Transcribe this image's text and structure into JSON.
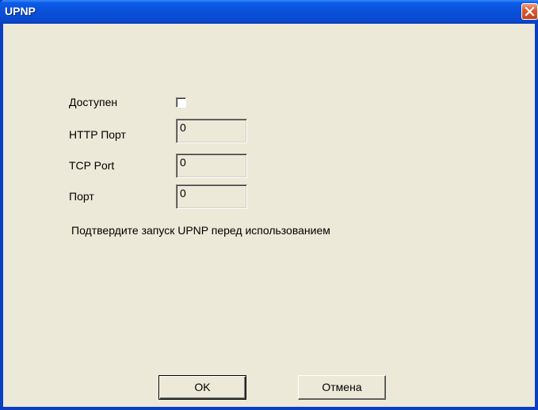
{
  "window": {
    "title": "UPNP",
    "title_bar_color": "#0a4fd8",
    "background_color": "#ece9d8"
  },
  "form": {
    "enabled_label": "Доступен",
    "enabled_checked": false,
    "http_port_label": "HTTP Порт",
    "http_port_value": "0",
    "tcp_port_label": "TCP Port",
    "tcp_port_value": "0",
    "port_label": "Порт",
    "port_value": "0",
    "hint_text": "Подтвердите запуск UPNP перед использованием"
  },
  "buttons": {
    "ok_label": "OK",
    "cancel_label": "Отмена"
  },
  "icons": {
    "close": "close-icon"
  }
}
